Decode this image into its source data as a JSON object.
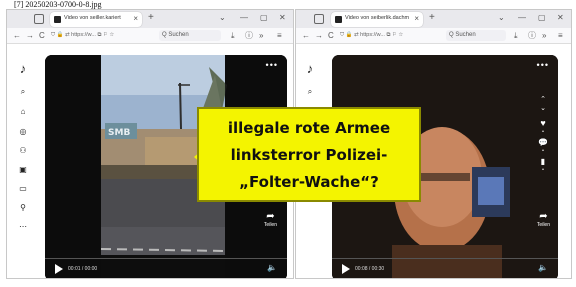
{
  "caption": "[7] 20250203-0700-0-8.jpg",
  "left_window": {
    "tab_title": "Video von seiller.kariert",
    "tab_close": "×",
    "new_tab": "+",
    "win_controls": [
      "⌄",
      "—",
      "▢",
      "✕"
    ],
    "nav_icons": [
      "←",
      "→",
      "C"
    ],
    "url": "⛉ 🔒 ⇄ https://w... ⧉ ⚐ ☆",
    "search": "Q Suchen",
    "toolbar_icons": [
      "⤓",
      "ⓘ",
      "»",
      "≡"
    ],
    "sidebar": [
      "♪",
      "⌕",
      "⌂",
      "◎",
      "⚇",
      "▣",
      "▭",
      "⚲",
      "⋯"
    ],
    "more": "•••",
    "share_arrow": "➦",
    "share_label": "Teilen",
    "time": "00:01 / 00:00",
    "volume": "🔈"
  },
  "right_window": {
    "tab_title": "Video von seiberlik.dachm",
    "tab_close": "×",
    "new_tab": "+",
    "win_controls": [
      "⌄",
      "—",
      "▢",
      "✕"
    ],
    "nav_icons": [
      "←",
      "→",
      "C"
    ],
    "url": "⛉ 🔒 ⇄ https://w... ⧉ ⚐ ☆",
    "search": "Q Suchen",
    "toolbar_icons": [
      "⤓",
      "ⓘ",
      "»",
      "≡"
    ],
    "sidebar": [
      "♪",
      "⌕",
      "⌂"
    ],
    "more": "•••",
    "side_actions": [
      "⌃",
      "⌄",
      "♥",
      "•",
      "💬",
      "•",
      "▮",
      "•"
    ],
    "share_arrow": "➦",
    "share_label": "Teilen",
    "time": "00:08 / 00:30",
    "volume": "🔈"
  },
  "overlay": {
    "line1": "illegale rote Armee",
    "line2": "linksterror Polizei-",
    "line3": "„Folter-Wache“?"
  }
}
